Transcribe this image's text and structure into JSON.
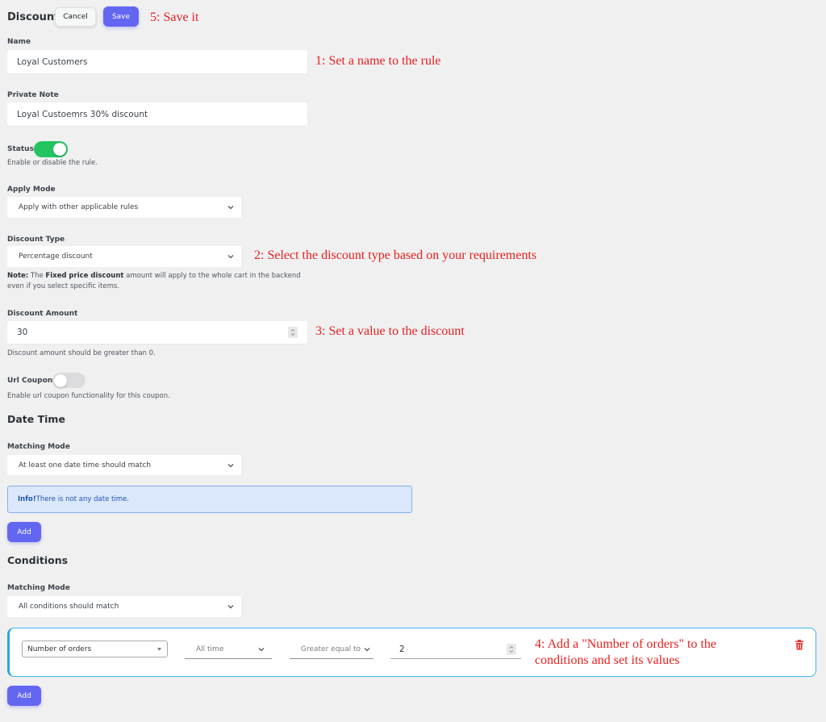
{
  "header": {
    "title": "Discount",
    "cancel_label": "Cancel",
    "save_label": "Save"
  },
  "fields": {
    "name": {
      "label": "Name",
      "value": "Loyal Customers"
    },
    "private_note": {
      "label": "Private Note",
      "value": "Loyal Custoemrs 30% discount"
    },
    "status": {
      "label": "Status",
      "enabled": true,
      "help": "Enable or disable the rule."
    },
    "apply_mode": {
      "label": "Apply Mode",
      "value": "Apply with other applicable rules"
    },
    "discount_type": {
      "label": "Discount Type",
      "value": "Percentage discount",
      "note_prefix": "Note:",
      "note_text_1": " The ",
      "note_bold": "Fixed price discount",
      "note_text_2": " amount will apply to the whole cart in the backend",
      "note_line2": "even if you select specific items."
    },
    "discount_amount": {
      "label": "Discount Amount",
      "value": "30",
      "help": "Discount amount should be greater than 0."
    },
    "url_coupon": {
      "label": "Url Coupon",
      "enabled": false,
      "help": "Enable url coupon functionality for this coupon."
    }
  },
  "date_time": {
    "heading": "Date Time",
    "matching_label": "Matching Mode",
    "matching_value": "At least one date time should match",
    "info_bold": "Info!",
    "info_text": " There is not any date time.",
    "add_label": "Add"
  },
  "conditions": {
    "heading": "Conditions",
    "matching_label": "Matching Mode",
    "matching_value": "All conditions should match",
    "rows": [
      {
        "type": "Number of orders",
        "period": "All time",
        "operator": "Greater equal to",
        "value": "2"
      }
    ],
    "add_label": "Add"
  },
  "annotations": {
    "a1": "1: Set a name to the rule",
    "a2": "2: Select the discount type based on your requirements",
    "a3": "3: Set a value to the discount",
    "a4_line1": "4: Add a \"Number of orders\" to the",
    "a4_line2": "conditions and set its values",
    "a5": "5: Save it"
  },
  "colors": {
    "primary": "#6366f1",
    "toggle_on": "#22c55e",
    "annotation": "#e8201f",
    "delete": "#e53935"
  }
}
